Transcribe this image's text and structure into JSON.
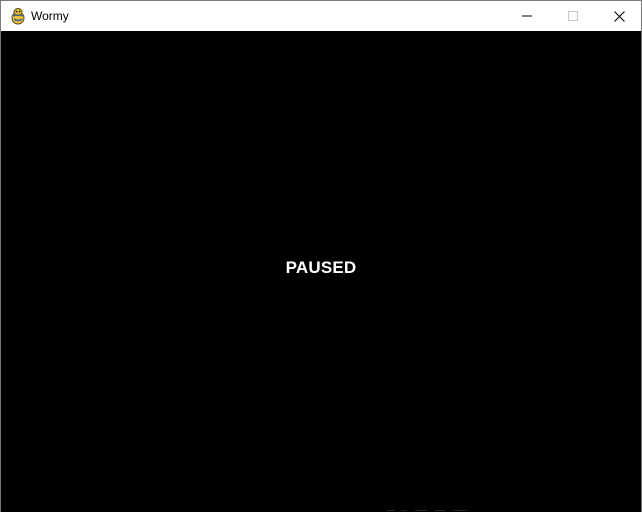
{
  "window": {
    "title": "Wormy",
    "icon": "pygame-snake-icon"
  },
  "controls": {
    "minimize_icon": "minimize-icon",
    "maximize_icon": "maximize-icon",
    "close_icon": "close-icon"
  },
  "game": {
    "status_text": "PAUSED",
    "background_color": "#000000",
    "text_color": "#ffffff"
  }
}
